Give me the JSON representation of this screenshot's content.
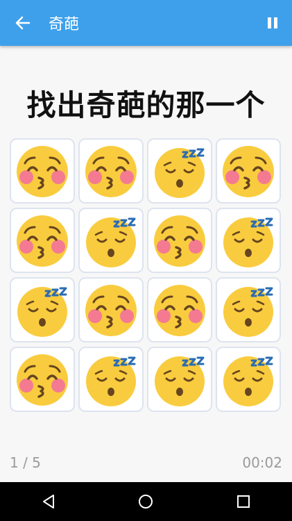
{
  "appbar": {
    "title": "奇葩",
    "back_icon": "back-arrow-icon",
    "pause_icon": "pause-icon"
  },
  "heading": "找出奇葩的那一个",
  "colors": {
    "appbar": "#3ea0eb",
    "face": "#f9cc3f",
    "blush": "#f47a91",
    "zzz": "#2a6cb4",
    "feature": "#66451f"
  },
  "grid": {
    "columns": 4,
    "cells": [
      "kissing-face",
      "kissing-face",
      "sleeping-face",
      "kissing-face",
      "kissing-face",
      "sleeping-face",
      "kissing-face",
      "sleeping-face",
      "sleeping-face",
      "kissing-face",
      "kissing-face",
      "sleeping-face",
      "kissing-face",
      "sleeping-face",
      "sleeping-face",
      "sleeping-face"
    ]
  },
  "footer": {
    "progress": "1 / 5",
    "timer": "00:02"
  },
  "navbar": {
    "back_icon": "nav-back-icon",
    "home_icon": "nav-home-icon",
    "recents_icon": "nav-recents-icon"
  }
}
